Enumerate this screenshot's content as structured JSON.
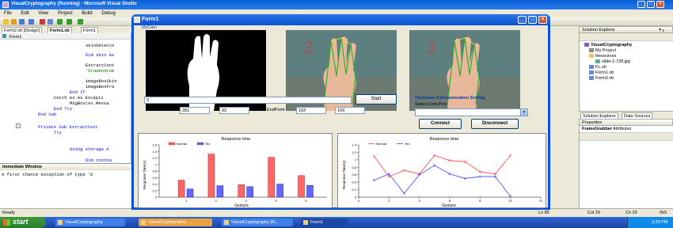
{
  "ide": {
    "title": "VisualCryptography (Running) - Microsoft Visual Studio",
    "menu": [
      "File",
      "Edit",
      "View",
      "Project",
      "Build",
      "Debug"
    ],
    "doc_tabs": [
      "Form2.vb [Design]",
      "Form1.vb",
      "Form1"
    ],
    "code_header": "Form1",
    "code_lines": [
      "skinDetecto",
      "Dim skin As",
      "ExtractCont",
      "'DrawAndCom",
      "imageBoxSkin",
      "imageBoxFra",
      "End If",
      "Catch ex As Excepti",
      "MsgBox(ex.Messa",
      "End Try",
      "End Sub",
      "Private Sub ExtractCont",
      "Try",
      "Using storage A",
      "Dim contou"
    ],
    "immediate_title": "Immediate Window",
    "immediate_text": "A first chance exception of type 'E",
    "status_left": "Ready",
    "status_ln": "Ln 85",
    "status_col": "Col 29",
    "status_ch": "Ch 29",
    "status_ins": "INS"
  },
  "solution": {
    "title": "Solution Explorer",
    "items": [
      "VisualCryptography",
      "My Project",
      "Resources",
      "slide-1-728.jpg",
      "FL.vb",
      "Form1.vb",
      "Form2.vb"
    ],
    "tabs": [
      "Solution Explorer",
      "Data Sources"
    ],
    "props_title": "Properties",
    "props_object": "FrameGrabber",
    "props_attr": "Attributes"
  },
  "taskbar": {
    "start": "start",
    "buttons": [
      "VisualCryptography",
      "VisualCryptography - ...",
      "VisualCryptography (R...",
      "Form1"
    ],
    "clock": "3:20 PM"
  },
  "form1": {
    "title": "Form1",
    "mycam": "MyCam",
    "input_value": "3",
    "start_button": "Start",
    "start_point_label": "StartPoint",
    "start_x": "281",
    "start_y": "92",
    "end_point_label": "EndPoint",
    "end_x": "102",
    "end_y": "169",
    "hw_title": "Hardware Communication Setting",
    "com_label": "Select Com.Port",
    "connect": "Connect",
    "disconnect": "Disconnect"
  },
  "chart_data": [
    {
      "type": "bar",
      "title": "Responce time",
      "xlabel": "Gesture",
      "ylabel": "Response Time(s)",
      "ylim": [
        0,
        1.6
      ],
      "yticks": [
        "0",
        "0.2",
        "0.4",
        "0.6",
        "0.8",
        "1",
        "1.2",
        "1.4",
        "1.6"
      ],
      "categories": [
        "1",
        "2",
        "3",
        "4",
        "5"
      ],
      "series": [
        {
          "name": "Normal",
          "color": "#ff6666",
          "values": [
            0.52,
            1.32,
            0.38,
            1.22,
            0.66
          ]
        },
        {
          "name": "Ten",
          "color": "#6666ff",
          "values": [
            0.25,
            0.35,
            0.32,
            0.4,
            0.36
          ]
        }
      ]
    },
    {
      "type": "line",
      "title": "Responce time",
      "xlabel": "Gesture",
      "ylabel": "Response Time(s)",
      "ylim": [
        0,
        1.4
      ],
      "yticks": [
        "0",
        "0.2",
        "0.4",
        "0.6",
        "0.8",
        "1",
        "1.2",
        "1.4"
      ],
      "xticks": [
        "0",
        "2",
        "4",
        "6",
        "8",
        "10",
        "12"
      ],
      "x": [
        1,
        2,
        3,
        4,
        5,
        6,
        7,
        8,
        9,
        10
      ],
      "series": [
        {
          "name": "Normal",
          "color": "#ff4444",
          "values": [
            1.1,
            0.55,
            0.72,
            0.62,
            1.12,
            0.98,
            0.95,
            0.68,
            0.62,
            1.12
          ]
        },
        {
          "name": "Ten",
          "color": "#4444ff",
          "values": [
            0.45,
            0.62,
            0.1,
            0.6,
            0.85,
            0.62,
            0.5,
            0.55,
            0.55,
            0.02
          ]
        }
      ]
    }
  ]
}
